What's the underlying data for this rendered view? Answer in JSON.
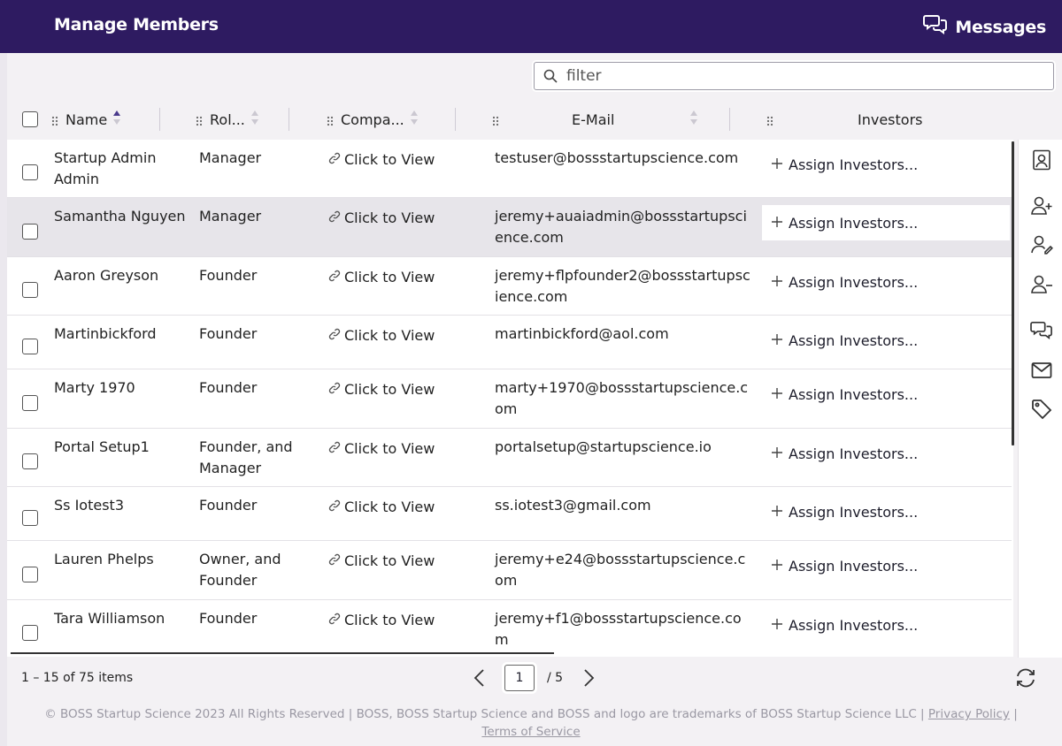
{
  "header": {
    "title": "Manage Members",
    "messages_label": "Messages"
  },
  "filter": {
    "placeholder": "filter",
    "value": ""
  },
  "columns": {
    "name": "Name",
    "role": "Rol...",
    "company": "Compa...",
    "email": "E-Mail",
    "investors": "Investors"
  },
  "rows": [
    {
      "name": "Startup Admin Admin",
      "role": "Manager",
      "company": "Click to View",
      "email": "testuser@bossstartupscience.com",
      "investors": "Assign Investors..."
    },
    {
      "name": "Samantha Nguyen",
      "role": "Manager",
      "company": "Click to View",
      "email": "jeremy+auaiadmin@bossstartupscience.com",
      "investors": "Assign Investors..."
    },
    {
      "name": "Aaron Greyson",
      "role": "Founder",
      "company": "Click to View",
      "email": "jeremy+flpfounder2@bossstartupscience.com",
      "investors": "Assign Investors..."
    },
    {
      "name": "Martinbickford",
      "role": "Founder",
      "company": "Click to View",
      "email": "martinbickford@aol.com",
      "investors": "Assign Investors..."
    },
    {
      "name": "Marty 1970",
      "role": "Founder",
      "company": "Click to View",
      "email": "marty+1970@bossstartupscience.com",
      "investors": "Assign Investors..."
    },
    {
      "name": "Portal Setup1",
      "role": "Founder, and Manager",
      "company": "Click to View",
      "email": "portalsetup@startupscience.io",
      "investors": "Assign Investors..."
    },
    {
      "name": "Ss Iotest3",
      "role": "Founder",
      "company": "Click to View",
      "email": "ss.iotest3@gmail.com",
      "investors": "Assign Investors..."
    },
    {
      "name": "Lauren Phelps",
      "role": "Owner, and Founder",
      "company": "Click to View",
      "email": "jeremy+e24@bossstartupscience.com",
      "investors": "Assign Investors..."
    },
    {
      "name": "Tara Williamson",
      "role": "Founder",
      "company": "Click to View",
      "email": "jeremy+f1@bossstartupscience.com",
      "investors": "Assign Investors..."
    }
  ],
  "pager": {
    "info": "1 – 15 of 75 items",
    "page": "1",
    "of": "/  5"
  },
  "footer": {
    "text": "© BOSS Startup Science 2023 All Rights Reserved | BOSS, BOSS Startup Science and BOSS and logo are trademarks of BOSS Startup Science LLC |",
    "privacy": "Privacy Policy",
    "sep": "|",
    "terms": "Terms of Service"
  },
  "icons": {
    "side": [
      "contact-card-icon",
      "add-user-icon",
      "edit-user-icon",
      "remove-user-icon",
      "chat-icon",
      "mail-icon",
      "tag-icon"
    ]
  },
  "colors": {
    "topbar": "#2e1b61",
    "sort_accent": "#4a3a8c",
    "highlight_row": "#e7e5ea"
  }
}
